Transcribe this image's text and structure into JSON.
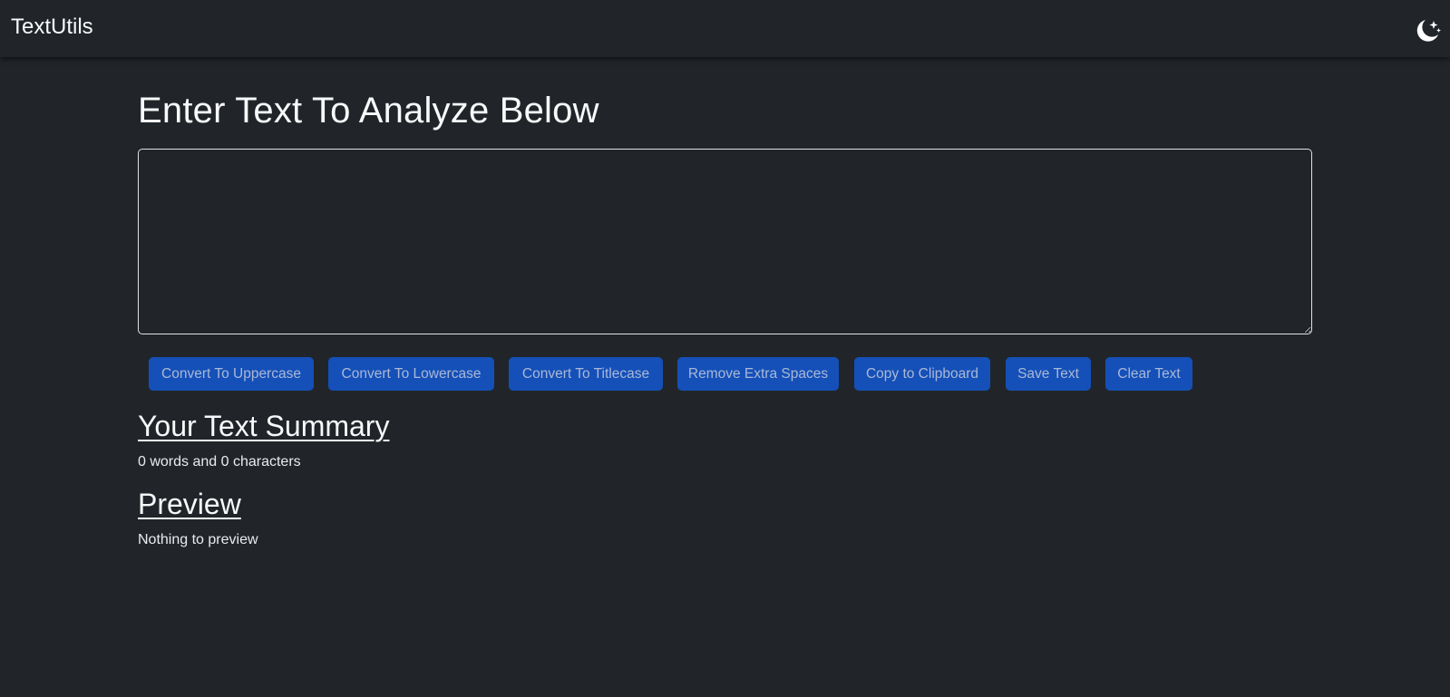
{
  "navbar": {
    "brand": "TextUtils",
    "theme_icon": "moon-stars-icon"
  },
  "main": {
    "heading": "Enter Text To Analyze Below",
    "textarea": {
      "value": "",
      "placeholder": ""
    },
    "buttons": [
      {
        "label": "Convert To Uppercase"
      },
      {
        "label": "Convert To Lowercase"
      },
      {
        "label": "Convert To Titlecase"
      },
      {
        "label": "Remove Extra Spaces"
      },
      {
        "label": "Copy to Clipboard"
      },
      {
        "label": "Save Text"
      },
      {
        "label": "Clear Text"
      }
    ],
    "summary": {
      "title": "Your Text Summary",
      "text": "0 words and 0 characters"
    },
    "preview": {
      "title": "Preview",
      "text": "Nothing to preview"
    }
  },
  "colors": {
    "background": "#212529",
    "button": "#1550b8",
    "text": "#f8f9fa"
  }
}
